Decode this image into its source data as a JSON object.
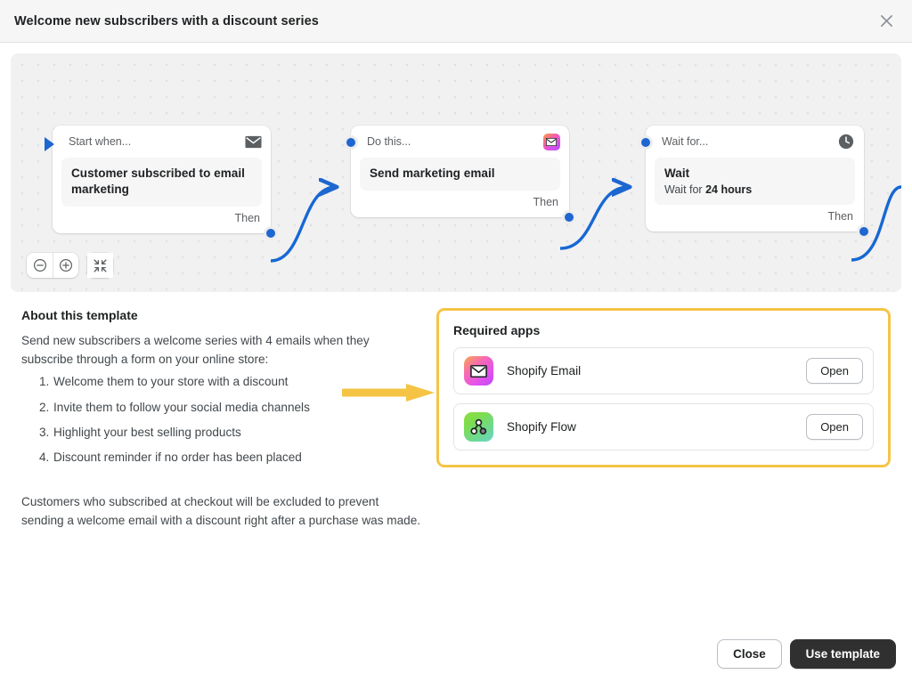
{
  "header": {
    "title": "Welcome new subscribers with a discount series",
    "close_icon": "close-icon"
  },
  "canvas": {
    "nodes": [
      {
        "head_label": "Start when...",
        "head_icon": "envelope-icon",
        "title": "Customer subscribed to email marketing",
        "subtitle": "",
        "foot_label": "Then"
      },
      {
        "head_label": "Do this...",
        "head_icon": "shopify-email-app-icon",
        "title": "Send marketing email",
        "subtitle": "",
        "foot_label": "Then"
      },
      {
        "head_label": "Wait for...",
        "head_icon": "clock-icon",
        "title": "Wait",
        "subtitle_prefix": "Wait for ",
        "subtitle_value": "24 hours",
        "foot_label": "Then"
      }
    ],
    "zoom_controls": {
      "zoom_out": "zoom-out-icon",
      "zoom_in": "zoom-in-icon",
      "fit": "fit-to-screen-icon"
    }
  },
  "about": {
    "title": "About this template",
    "intro": "Send new subscribers a welcome series with 4 emails when they subscribe through a form on your online store:",
    "steps": [
      {
        "num": "1.",
        "text": "Welcome them to your store with a discount"
      },
      {
        "num": "2.",
        "text": "Invite them to follow your social media channels"
      },
      {
        "num": "3.",
        "text": "Highlight your best selling products"
      },
      {
        "num": "4.",
        "text": "Discount reminder if no order has been placed"
      }
    ],
    "note": "Customers who subscribed at checkout will be excluded to prevent sending a welcome email with a discount right after a purchase was made.",
    "annotation_arrow_color": "#f5c444"
  },
  "required_apps": {
    "title": "Required apps",
    "highlight_color": "#f5c444",
    "apps": [
      {
        "name": "Shopify Email",
        "icon": "shopify-email-app-icon",
        "action_label": "Open"
      },
      {
        "name": "Shopify Flow",
        "icon": "shopify-flow-app-icon",
        "action_label": "Open"
      }
    ]
  },
  "footer": {
    "close_label": "Close",
    "use_template_label": "Use template"
  }
}
